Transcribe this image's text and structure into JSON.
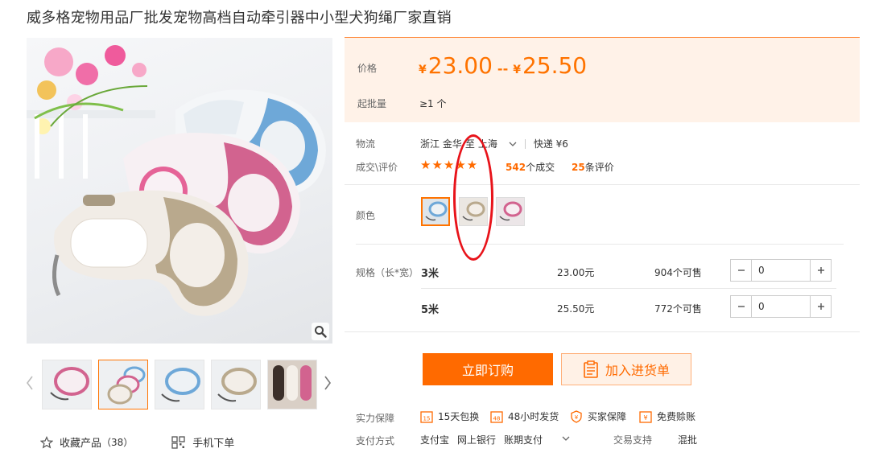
{
  "product": {
    "title": "威多格宠物用品厂批发宠物高档自动牵引器中小型犬狗绳厂家直销"
  },
  "gallery": {
    "zoom_icon": "magnifier-icon",
    "prev_icon": "chevron-left-icon",
    "next_icon": "chevron-right-icon",
    "thumb_count": 5,
    "active_thumb": 2
  },
  "actions": {
    "favorite_label": "收藏产品",
    "favorite_count": "（38）",
    "mobile_order_label": "手机下单"
  },
  "price_box": {
    "price_label": "价格",
    "currency": "¥",
    "price_min": "23.00",
    "price_sep": "--",
    "price_max": "25.50",
    "moq_label": "起批量",
    "moq_value": "≥1 个"
  },
  "logistics": {
    "label": "物流",
    "from": "浙江 金华",
    "to_prefix": "至",
    "to": "上海",
    "shipping": "快递 ¥6"
  },
  "reviews": {
    "label": "成交\\评价",
    "rating": 5,
    "stars": "★★★★★",
    "deals_count": "542",
    "deals_label": "个成交",
    "reviews_count": "25",
    "reviews_label": "条评价"
  },
  "color": {
    "label": "颜色",
    "selected_index": 0,
    "swatch_count": 3
  },
  "specs": {
    "label": "规格（长*宽）",
    "rows": [
      {
        "name": "3米",
        "price": "23.00元",
        "stock": "904个可售",
        "qty": "0"
      },
      {
        "name": "5米",
        "price": "25.50元",
        "stock": "772个可售",
        "qty": "0"
      }
    ]
  },
  "buttons": {
    "buy_now": "立即订购",
    "add_to_cart": "加入进货单"
  },
  "guarantee": {
    "label": "实力保障",
    "items": [
      "15天包换",
      "48小时发货",
      "买家保障",
      "免费赊账"
    ]
  },
  "payment": {
    "label": "支付方式",
    "methods": [
      "支付宝",
      "网上银行",
      "账期支付"
    ],
    "trade_label": "交易支持",
    "trade_value": "混批"
  },
  "colors": {
    "accent": "#ff6a00",
    "price_bg": "#fff2e8",
    "annotation": "#e8131a"
  }
}
